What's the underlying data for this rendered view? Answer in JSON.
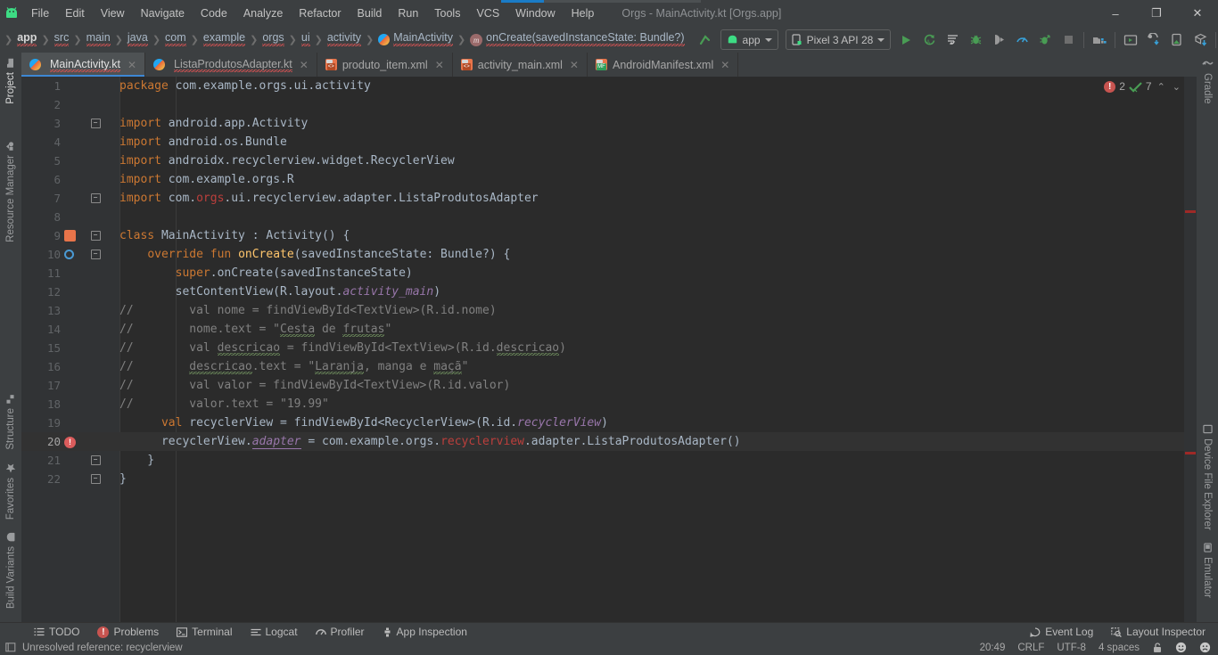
{
  "window": {
    "title": "Orgs - MainActivity.kt [Orgs.app]",
    "menu": [
      "File",
      "Edit",
      "View",
      "Navigate",
      "Code",
      "Analyze",
      "Refactor",
      "Build",
      "Run",
      "Tools",
      "VCS",
      "Window",
      "Help"
    ],
    "controls": {
      "minimize": "–",
      "maximize": "❐",
      "close": "✕"
    },
    "progress_percent": 21
  },
  "breadcrumbs": [
    {
      "label": "app",
      "icon": "module-icon",
      "bold": true
    },
    {
      "label": "src",
      "icon": "",
      "bold": false
    },
    {
      "label": "main",
      "icon": "",
      "bold": false
    },
    {
      "label": "java",
      "icon": "",
      "bold": false
    },
    {
      "label": "com",
      "icon": "",
      "bold": false
    },
    {
      "label": "example",
      "icon": "",
      "bold": false
    },
    {
      "label": "orgs",
      "icon": "",
      "bold": false
    },
    {
      "label": "ui",
      "icon": "",
      "bold": false
    },
    {
      "label": "activity",
      "icon": "",
      "bold": false
    },
    {
      "label": "MainActivity",
      "icon": "kotlin-class-icon",
      "bold": false
    },
    {
      "label": "onCreate(savedInstanceState: Bundle?)",
      "icon": "method-icon",
      "bold": false
    }
  ],
  "toolbar": {
    "run_config_label": "app",
    "device_label": "Pixel 3 API 28",
    "buttons": [
      "run-button",
      "apply-changes-button",
      "apply-code-changes-button",
      "debug-button",
      "attach-debugger-button",
      "profiler-button",
      "run-with-coverage-button",
      "stop-button",
      "sdk-manager-button",
      "avd-manager-button",
      "sync-gradle-button",
      "device-manager-button",
      "layout-inspector-button",
      "search-button",
      "avatar-button"
    ]
  },
  "editor_tabs": [
    {
      "label": "MainActivity.kt",
      "icon": "kotlin-file-icon",
      "active": true
    },
    {
      "label": "ListaProdutosAdapter.kt",
      "icon": "kotlin-file-icon",
      "active": false
    },
    {
      "label": "produto_item.xml",
      "icon": "xml-file-icon",
      "active": false
    },
    {
      "label": "activity_main.xml",
      "icon": "xml-file-icon",
      "active": false
    },
    {
      "label": "AndroidManifest.xml",
      "icon": "manifest-file-icon",
      "active": false
    }
  ],
  "inspections": {
    "error_count": "2",
    "warning_count": "7"
  },
  "left_rail": [
    {
      "label": "Project",
      "icon": "project-icon"
    },
    {
      "label": "Resource Manager",
      "icon": "resource-manager-icon"
    },
    {
      "label": "Structure",
      "icon": "structure-icon"
    },
    {
      "label": "Favorites",
      "icon": "star-icon"
    },
    {
      "label": "Build Variants",
      "icon": "build-variants-icon"
    }
  ],
  "right_rail": [
    {
      "label": "Gradle",
      "icon": "gradle-icon"
    },
    {
      "label": "Device File Explorer",
      "icon": "device-file-explorer-icon"
    },
    {
      "label": "Emulator",
      "icon": "emulator-icon"
    }
  ],
  "code": {
    "language": "kotlin",
    "current_line": 20,
    "lines": [
      {
        "n": 1,
        "fold": "",
        "marker": "",
        "html": "<span class=\"kw\">package</span> com.example.orgs.ui.activity"
      },
      {
        "n": 2,
        "fold": "",
        "marker": "",
        "html": ""
      },
      {
        "n": 3,
        "fold": "-",
        "marker": "",
        "html": "<span class=\"kw\">import</span> android.app.Activity"
      },
      {
        "n": 4,
        "fold": "",
        "marker": "",
        "html": "<span class=\"kw\">import</span> android.os.Bundle"
      },
      {
        "n": 5,
        "fold": "",
        "marker": "",
        "html": "<span class=\"kw\">import</span> androidx.recyclerview.widget.RecyclerView"
      },
      {
        "n": 6,
        "fold": "",
        "marker": "",
        "html": "<span class=\"kw\">import</span> com.example.orgs.R"
      },
      {
        "n": 7,
        "fold": "-",
        "marker": "",
        "html": "<span class=\"kw\">import</span> com.<span class=\"err\">orgs</span>.ui.recyclerview.adapter.ListaProdutosAdapter"
      },
      {
        "n": 8,
        "fold": "",
        "marker": "",
        "html": ""
      },
      {
        "n": 9,
        "fold": "-",
        "marker": "class",
        "html": "<span class=\"kw\">class</span> MainActivity : Activity() {"
      },
      {
        "n": 10,
        "fold": "-",
        "marker": "run",
        "html": "    <span class=\"kw\">override fun</span> <span class=\"fn\">onCreate</span>(savedInstanceState: Bundle?) {"
      },
      {
        "n": 11,
        "fold": "",
        "marker": "",
        "html": "        <span class=\"kw\">super</span>.onCreate(savedInstanceState)"
      },
      {
        "n": 12,
        "fold": "",
        "marker": "",
        "html": "        setContentView(R.layout.<span class=\"fld\">activity_main</span>)"
      },
      {
        "n": 13,
        "fold": "",
        "marker": "",
        "html": "<span class=\"cmt\">//        val nome = findViewById&lt;TextView&gt;(R.id.nome)</span>"
      },
      {
        "n": 14,
        "fold": "",
        "marker": "",
        "html": "<span class=\"cmt\">//        nome.text = \"<span class=\"wavy-g\">Cesta</span> de <span class=\"wavy-g\">frutas</span>\"</span>"
      },
      {
        "n": 15,
        "fold": "",
        "marker": "",
        "html": "<span class=\"cmt\">//        val <span class=\"wavy-g\">descricao</span> = findViewById&lt;TextView&gt;(R.id.<span class=\"wavy-g\">descricao</span>)</span>"
      },
      {
        "n": 16,
        "fold": "",
        "marker": "",
        "html": "<span class=\"cmt\">//        <span class=\"wavy-g\">descricao</span>.text = \"<span class=\"wavy-g\">Laranja</span>, manga e <span class=\"wavy-g\">maçã</span>\"</span>"
      },
      {
        "n": 17,
        "fold": "",
        "marker": "",
        "html": "<span class=\"cmt\">//        val valor = findViewById&lt;TextView&gt;(R.id.valor)</span>"
      },
      {
        "n": 18,
        "fold": "",
        "marker": "",
        "html": "<span class=\"cmt\">//        valor.text = \"19.99\"</span>"
      },
      {
        "n": 19,
        "fold": "",
        "marker": "",
        "html": "      <span class=\"kw\">val</span> recyclerView = findViewById&lt;RecyclerView&gt;(R.id.<span class=\"fld\">recyclerView</span>)"
      },
      {
        "n": 20,
        "fold": "",
        "marker": "error",
        "html": "      recyclerView.<span class=\"fld under\">adapter</span> = com.example.orgs.<span class=\"err\">recyclerview</span>.adapter.ListaProdutosAdapter()"
      },
      {
        "n": 21,
        "fold": "-",
        "marker": "",
        "html": "    }"
      },
      {
        "n": 22,
        "fold": "-",
        "marker": "",
        "html": "}"
      }
    ],
    "plain_lines": [
      "package com.example.orgs.ui.activity",
      "",
      "import android.app.Activity",
      "import android.os.Bundle",
      "import androidx.recyclerview.widget.RecyclerView",
      "import com.example.orgs.R",
      "import com.orgs.ui.recyclerview.adapter.ListaProdutosAdapter",
      "",
      "class MainActivity : Activity() {",
      "    override fun onCreate(savedInstanceState: Bundle?) {",
      "        super.onCreate(savedInstanceState)",
      "        setContentView(R.layout.activity_main)",
      "//        val nome = findViewById<TextView>(R.id.nome)",
      "//        nome.text = \"Cesta de frutas\"",
      "//        val descricao = findViewById<TextView>(R.id.descricao)",
      "//        descricao.text = \"Laranja, manga e maçã\"",
      "//        val valor = findViewById<TextView>(R.id.valor)",
      "//        valor.text = \"19.99\"",
      "      val recyclerView = findViewById<RecyclerView>(R.id.recyclerView)",
      "      recyclerView.adapter = com.example.orgs.recyclerview.adapter.ListaProdutosAdapter()",
      "    }",
      "}"
    ]
  },
  "bottom_tools": [
    {
      "label": "TODO",
      "icon": "todo-icon"
    },
    {
      "label": "Problems",
      "icon": "problems-icon"
    },
    {
      "label": "Terminal",
      "icon": "terminal-icon"
    },
    {
      "label": "Logcat",
      "icon": "logcat-icon"
    },
    {
      "label": "Profiler",
      "icon": "profiler-icon"
    },
    {
      "label": "App Inspection",
      "icon": "app-inspection-icon"
    }
  ],
  "bottom_tools_right": [
    {
      "label": "Event Log",
      "icon": "event-log-icon"
    },
    {
      "label": "Layout Inspector",
      "icon": "layout-inspector-icon"
    }
  ],
  "status": {
    "message": "Unresolved reference: recyclerview",
    "position": "20:49",
    "line_separator": "CRLF",
    "encoding": "UTF-8",
    "indent": "4 spaces",
    "lock": "unlocked-icon",
    "faces": [
      "happy-face-icon",
      "sad-face-icon"
    ]
  },
  "colors": {
    "editor_bg": "#2b2b2b",
    "chrome_bg": "#3c3f41",
    "gutter_bg": "#313335",
    "accent_blue": "#3d87d4",
    "error_red": "#bc3f3c",
    "keyword_orange": "#cc7832",
    "string_green": "#6a8759",
    "run_green": "#499c54"
  }
}
